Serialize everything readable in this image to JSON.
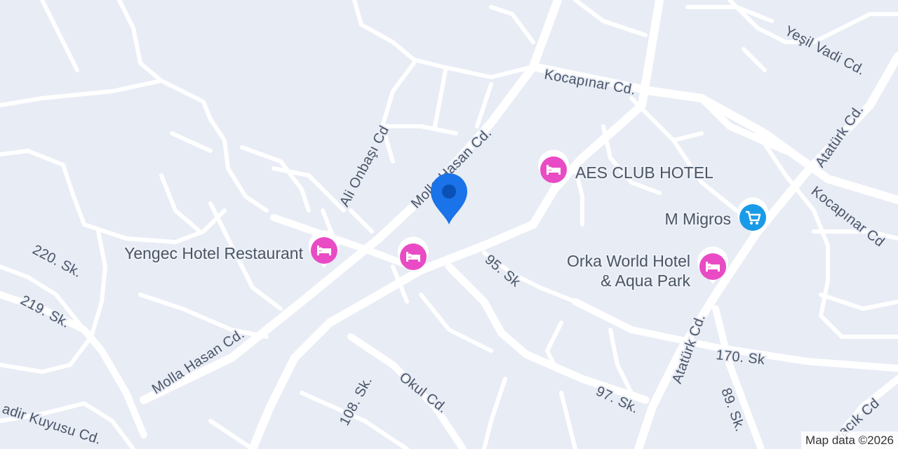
{
  "map": {
    "streets": {
      "molla_hasan_upper": "Molla Hasan Cd.",
      "molla_hasan_lower": "Molla Hasan Cd.",
      "ali_onbasi": "Ali Onbaşı Cd",
      "kocapinar_top": "Kocapınar Cd.",
      "kocapinar_right": "Kocapınar Cd",
      "yesil_vadi": "Yeşil Vadi Cd.",
      "ataturk_upper": "Atatürk Cd.",
      "ataturk_lower": "Atatürk Cd.",
      "sk_220": "220. Sk.",
      "sk_219": "219. Sk.",
      "sk_95": "95. Sk",
      "sk_170": "170. Sk",
      "sk_97": "97. Sk.",
      "sk_89": "89. Sk.",
      "sk_108": "108. Sk.",
      "okul": "Okul Cd.",
      "kadir_kuyusu": "adir Kuyusu Cd.",
      "bottom_right": "vacık Cd"
    },
    "pois": {
      "yengec": {
        "name": "Yengec Hotel Restaurant",
        "icon": "hotel-icon"
      },
      "unnamed_hotel": {
        "icon": "hotel-icon"
      },
      "aes": {
        "name": "AES CLUB HOTEL",
        "icon": "hotel-icon"
      },
      "migros": {
        "name": "M Migros",
        "icon": "shopping-cart-icon"
      },
      "orka_line1": "Orka World Hotel",
      "orka_line2": "& Aqua Park"
    },
    "location_pin": {
      "icon": "location-pin-icon",
      "color": "#1a73e8"
    },
    "attribution": "Map data ©2026",
    "colors": {
      "background": "#e8ecf5",
      "road": "#ffffff",
      "hotel_marker": "#e94bc4",
      "shop_marker": "#1a9be8",
      "label": "#4a5568"
    }
  }
}
